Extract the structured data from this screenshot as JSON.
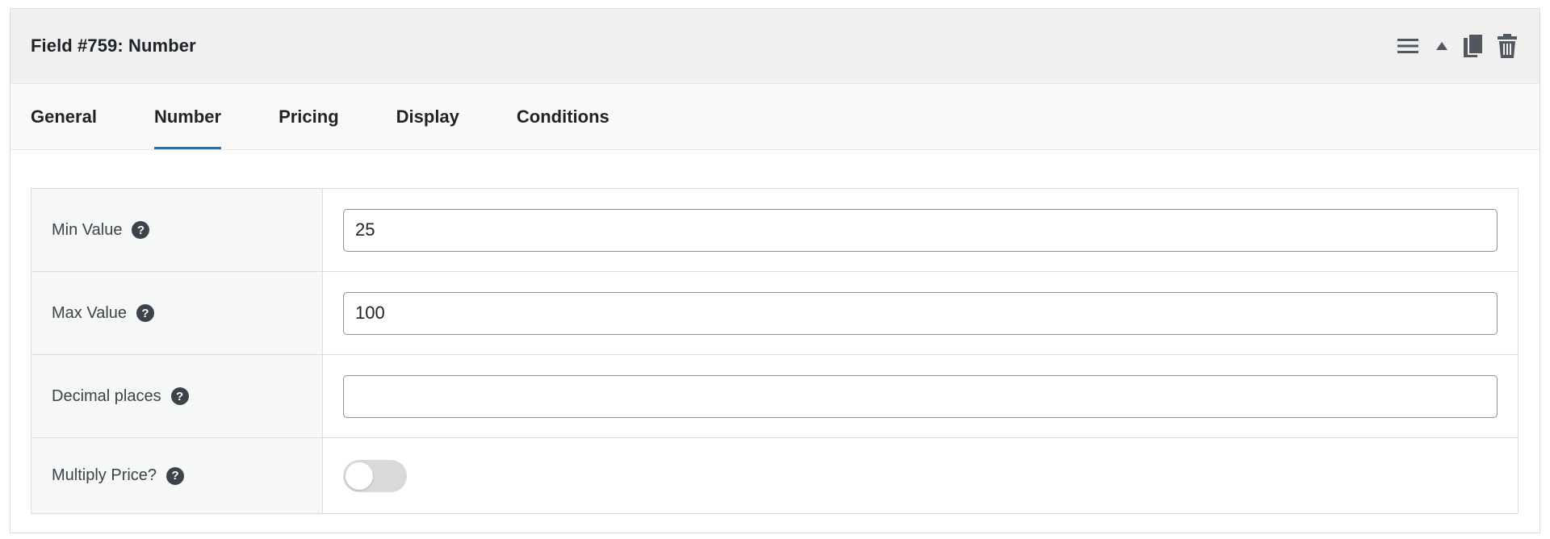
{
  "panel": {
    "title": "Field #759: Number",
    "actions": [
      {
        "icon": "menu-lines-icon"
      },
      {
        "icon": "collapse-arrow-icon"
      },
      {
        "icon": "duplicate-icon"
      },
      {
        "icon": "trash-icon"
      }
    ]
  },
  "tabs": [
    {
      "label": "General",
      "active": false
    },
    {
      "label": "Number",
      "active": true
    },
    {
      "label": "Pricing",
      "active": false
    },
    {
      "label": "Display",
      "active": false
    },
    {
      "label": "Conditions",
      "active": false
    }
  ],
  "form": {
    "min_value": {
      "label": "Min Value",
      "value": "25",
      "help": "?"
    },
    "max_value": {
      "label": "Max Value",
      "value": "100",
      "help": "?"
    },
    "decimal_places": {
      "label": "Decimal places",
      "value": "",
      "help": "?"
    },
    "multiply_price": {
      "label": "Multiply Price?",
      "enabled": false,
      "help": "?"
    }
  },
  "colors": {
    "accent": "#2271b1",
    "header_bg": "#f0f0f1",
    "icon": "#50575e",
    "toggle_off": "#d9d9d9"
  }
}
